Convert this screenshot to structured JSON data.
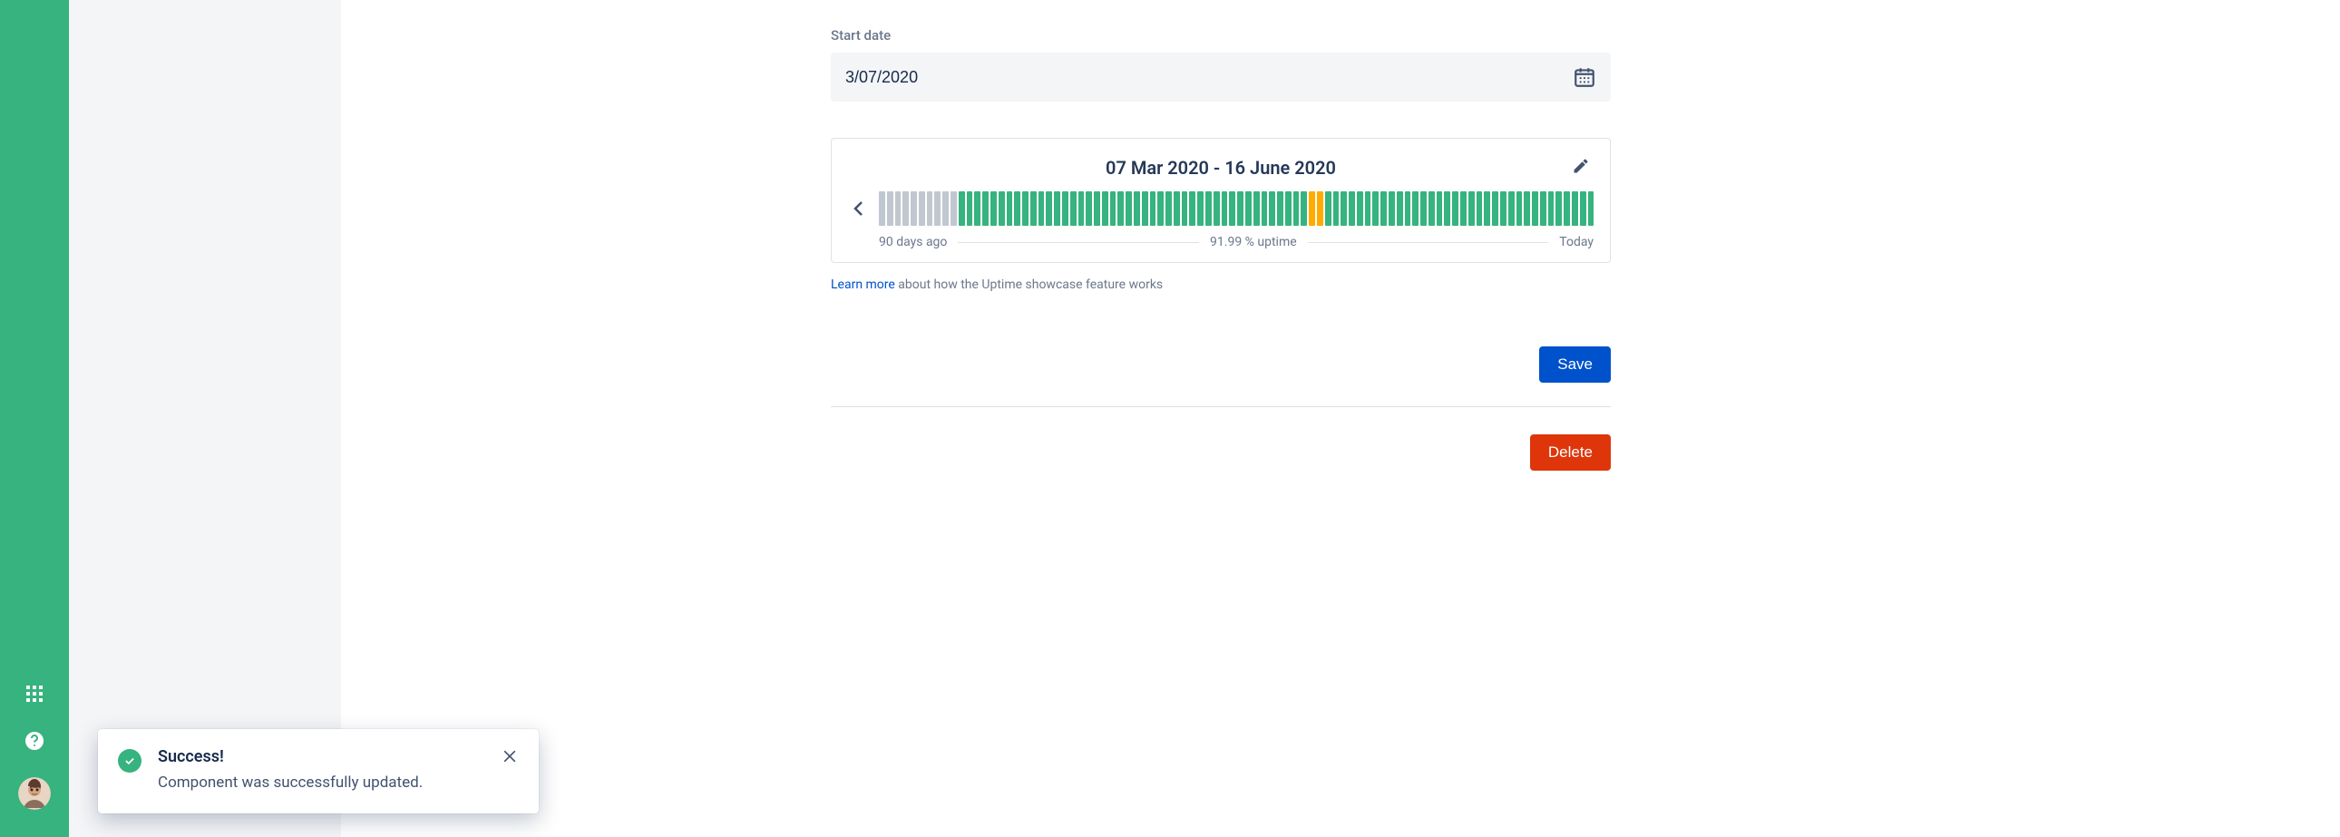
{
  "form": {
    "start_date_label": "Start date",
    "start_date_value": "3/07/2020"
  },
  "uptime": {
    "range_label": "07 Mar 2020 - 16 June 2020",
    "left_label": "90 days ago",
    "center_label": "91.99 % uptime",
    "right_label": "Today",
    "bars": [
      "gray",
      "gray",
      "gray",
      "gray",
      "gray",
      "gray",
      "gray",
      "gray",
      "gray",
      "gray",
      "green",
      "green",
      "green",
      "green",
      "green",
      "green",
      "green",
      "green",
      "green",
      "green",
      "green",
      "green",
      "green",
      "green",
      "green",
      "green",
      "green",
      "green",
      "green",
      "green",
      "green",
      "green",
      "green",
      "green",
      "green",
      "green",
      "green",
      "green",
      "green",
      "green",
      "green",
      "green",
      "green",
      "green",
      "green",
      "green",
      "green",
      "green",
      "green",
      "green",
      "green",
      "green",
      "green",
      "green",
      "orange",
      "orange",
      "green",
      "green",
      "green",
      "green",
      "green",
      "green",
      "green",
      "green",
      "green",
      "green",
      "green",
      "green",
      "green",
      "green",
      "green",
      "green",
      "green",
      "green",
      "green",
      "green",
      "green",
      "green",
      "green",
      "green",
      "green",
      "green",
      "green",
      "green",
      "green",
      "green",
      "green",
      "green",
      "green",
      "green"
    ]
  },
  "help": {
    "link_text": "Learn more",
    "suffix_text": " about how the Uptime showcase feature works"
  },
  "buttons": {
    "save": "Save",
    "delete": "Delete"
  },
  "toast": {
    "title": "Success!",
    "message": "Component was successfully updated."
  }
}
